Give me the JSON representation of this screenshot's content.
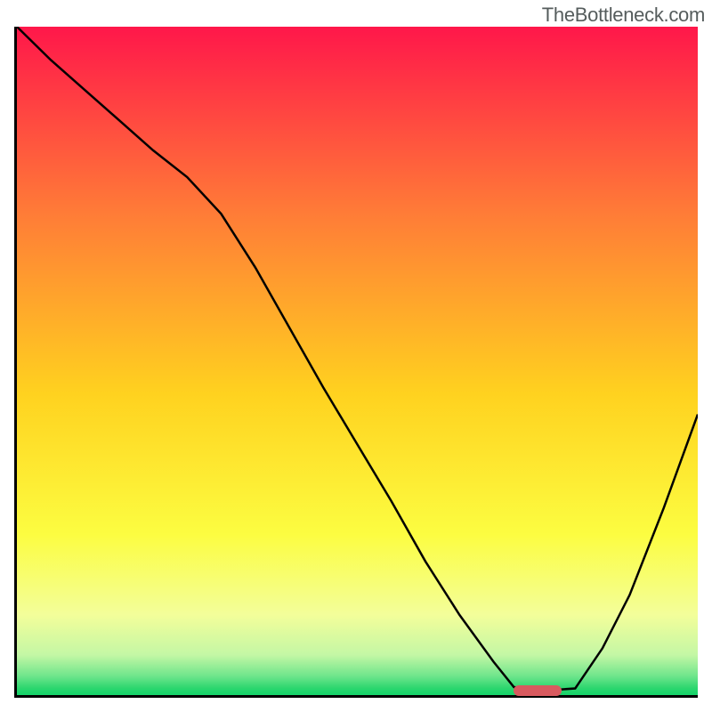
{
  "watermark": "TheBottleneck.com",
  "chart_data": {
    "type": "line",
    "title": "",
    "xlabel": "",
    "ylabel": "",
    "xlim": [
      0,
      100
    ],
    "ylim": [
      0,
      100
    ],
    "background_gradient": [
      {
        "stop": 0.0,
        "color": "#ff174a"
      },
      {
        "stop": 0.28,
        "color": "#ff7c37"
      },
      {
        "stop": 0.55,
        "color": "#ffd21f"
      },
      {
        "stop": 0.76,
        "color": "#fcfd41"
      },
      {
        "stop": 0.88,
        "color": "#f3fe9a"
      },
      {
        "stop": 0.94,
        "color": "#c4f7a5"
      },
      {
        "stop": 0.972,
        "color": "#6de58b"
      },
      {
        "stop": 0.99,
        "color": "#2bd66e"
      },
      {
        "stop": 1.0,
        "color": "#14d46a"
      }
    ],
    "series": [
      {
        "name": "bottleneck-curve",
        "x": [
          0,
          5,
          10,
          15,
          20,
          25,
          30,
          35,
          40,
          45,
          50,
          55,
          60,
          65,
          70,
          73,
          78,
          82,
          86,
          90,
          95,
          100
        ],
        "y": [
          100,
          95,
          90.5,
          86,
          81.5,
          77.5,
          72,
          64,
          55,
          46,
          37.5,
          29,
          20,
          12,
          5,
          1.2,
          0.7,
          1,
          7,
          15,
          28,
          42
        ]
      }
    ],
    "marker": {
      "x_start": 73,
      "x_end": 80,
      "y": 0.7,
      "color": "#d85a5f"
    }
  }
}
